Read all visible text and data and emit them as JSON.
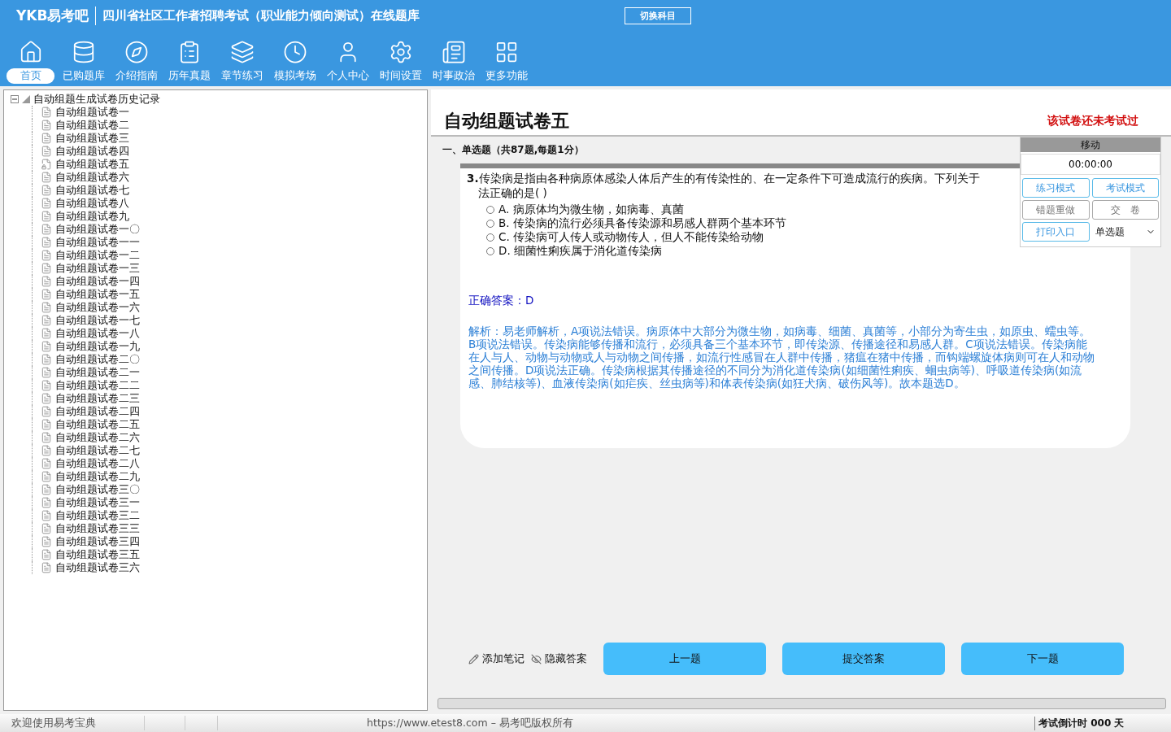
{
  "header": {
    "logo": "YKB易考吧",
    "title": "四川省社区工作者招聘考试（职业能力倾向测试）在线题库",
    "switch_button": "切换科目"
  },
  "nav": [
    {
      "label": "首页",
      "selected": true
    },
    {
      "label": "已购题库",
      "selected": false
    },
    {
      "label": "介绍指南",
      "selected": false
    },
    {
      "label": "历年真题",
      "selected": false
    },
    {
      "label": "章节练习",
      "selected": false
    },
    {
      "label": "模拟考场",
      "selected": false
    },
    {
      "label": "个人中心",
      "selected": false
    },
    {
      "label": "时间设置",
      "selected": false
    },
    {
      "label": "时事政治",
      "selected": false
    },
    {
      "label": "更多功能",
      "selected": false
    }
  ],
  "tree": {
    "label": "自动组题生成试卷历史记录",
    "expanded": true,
    "children": [
      {
        "label": "自动组题试卷一",
        "kind": "doc"
      },
      {
        "label": "自动组题试卷二",
        "kind": "doc"
      },
      {
        "label": "自动组题试卷三",
        "kind": "doc"
      },
      {
        "label": "自动组题试卷四",
        "kind": "doc"
      },
      {
        "label": "自动组题试卷五",
        "kind": "current"
      },
      {
        "label": "自动组题试卷六",
        "kind": "doc"
      },
      {
        "label": "自动组题试卷七",
        "kind": "doc"
      },
      {
        "label": "自动组题试卷八",
        "kind": "doc"
      },
      {
        "label": "自动组题试卷九",
        "kind": "doc"
      },
      {
        "label": "自动组题试卷一〇",
        "kind": "doc"
      },
      {
        "label": "自动组题试卷一一",
        "kind": "doc"
      },
      {
        "label": "自动组题试卷一二",
        "kind": "doc"
      },
      {
        "label": "自动组题试卷一三",
        "kind": "doc"
      },
      {
        "label": "自动组题试卷一四",
        "kind": "doc"
      },
      {
        "label": "自动组题试卷一五",
        "kind": "doc"
      },
      {
        "label": "自动组题试卷一六",
        "kind": "doc"
      },
      {
        "label": "自动组题试卷一七",
        "kind": "doc"
      },
      {
        "label": "自动组题试卷一八",
        "kind": "doc"
      },
      {
        "label": "自动组题试卷一九",
        "kind": "doc"
      },
      {
        "label": "自动组题试卷二〇",
        "kind": "doc"
      },
      {
        "label": "自动组题试卷二一",
        "kind": "doc"
      },
      {
        "label": "自动组题试卷二二",
        "kind": "doc"
      },
      {
        "label": "自动组题试卷二三",
        "kind": "doc"
      },
      {
        "label": "自动组题试卷二四",
        "kind": "doc"
      },
      {
        "label": "自动组题试卷二五",
        "kind": "doc"
      },
      {
        "label": "自动组题试卷二六",
        "kind": "doc"
      },
      {
        "label": "自动组题试卷二七",
        "kind": "doc"
      },
      {
        "label": "自动组题试卷二八",
        "kind": "doc"
      },
      {
        "label": "自动组题试卷二九",
        "kind": "doc"
      },
      {
        "label": "自动组题试卷三〇",
        "kind": "doc"
      },
      {
        "label": "自动组题试卷三一",
        "kind": "doc"
      },
      {
        "label": "自动组题试卷三二",
        "kind": "doc"
      },
      {
        "label": "自动组题试卷三三",
        "kind": "doc"
      },
      {
        "label": "自动组题试卷三四",
        "kind": "doc"
      },
      {
        "label": "自动组题试卷三五",
        "kind": "doc"
      },
      {
        "label": "自动组题试卷三六",
        "kind": "doc"
      }
    ]
  },
  "paper": {
    "title": "自动组题试卷五",
    "status": "该试卷还未考试过",
    "section": "一、单选题（共87题,每题1分）",
    "question": {
      "number": "3.",
      "lines": [
        "传染病是指由各种病原体感染人体后产生的有传染性的、在一定条件下可造成流行的疾病。下列关于",
        "法正确的是( )"
      ],
      "options": [
        {
          "label": "A. 病原体均为微生物，如病毒、真菌",
          "selected": false
        },
        {
          "label": "B. 传染病的流行必须具备传染源和易感人群两个基本环节",
          "selected": false
        },
        {
          "label": "C. 传染病可人传人或动物传人，但人不能传染给动物",
          "selected": false
        },
        {
          "label": "D. 细菌性痢疾属于消化道传染病",
          "selected": false
        }
      ],
      "answer": "正确答案：D",
      "analysis": "解析：易老师解析，A项说法错误。病原体中大部分为微生物，如病毒、细菌、真菌等，小部分为寄生虫，如原虫、蠕虫等。B项说法错误。传染病能够传播和流行，必须具备三个基本环节，即传染源、传播途径和易感人群。C项说法错误。传染病能在人与人、动物与动物或人与动物之间传播，如流行性感冒在人群中传播，猪瘟在猪中传播，而钩端螺旋体病则可在人和动物之间传播。D项说法正确。传染病根据其传播途径的不同分为消化道传染病(如细菌性痢疾、蛔虫病等)、呼吸道传染病(如流感、肺结核等)、血液传染病(如疟疾、丝虫病等)和体表传染病(如狂犬病、破伤风等)。故本题选D。"
    },
    "tools": [
      "添加笔记",
      "隐藏答案"
    ],
    "buttons": [
      "上一题",
      "提交答案",
      "下一题"
    ]
  },
  "panel": {
    "title": "移动",
    "timer": "00:00:00",
    "buttons": [
      {
        "label": "练习模式",
        "disabled": false
      },
      {
        "label": "考试模式",
        "disabled": false
      },
      {
        "label": "错题重做",
        "disabled": true
      },
      {
        "label": "交　卷",
        "disabled": true
      },
      {
        "label": "打印入口",
        "disabled": false
      }
    ],
    "type_select": "单选题"
  },
  "status_bar": {
    "welcome": "欢迎使用易考宝典",
    "copyright": "https://www.etest8.com – 易考吧版权所有",
    "countdown": "考试倒计时 000 天"
  }
}
